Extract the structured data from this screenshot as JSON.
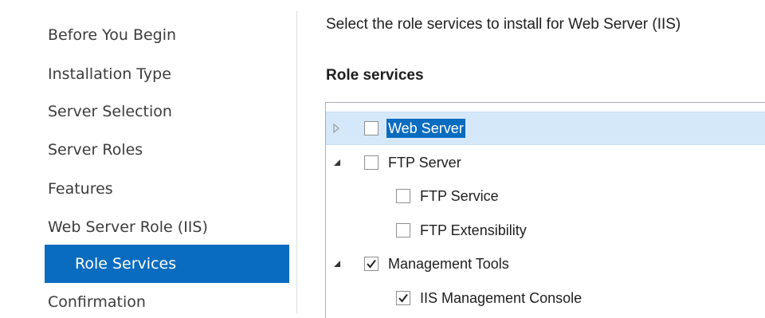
{
  "nav": {
    "items": [
      {
        "label": "Before You Begin",
        "selected": false
      },
      {
        "label": "Installation Type",
        "selected": false
      },
      {
        "label": "Server Selection",
        "selected": false
      },
      {
        "label": "Server Roles",
        "selected": false
      },
      {
        "label": "Features",
        "selected": false
      },
      {
        "label": "Web Server Role (IIS)",
        "selected": false
      },
      {
        "label": "Role Services",
        "selected": true
      },
      {
        "label": "Confirmation",
        "selected": false
      }
    ]
  },
  "main": {
    "instruction": "Select the role services to install for Web Server (IIS)",
    "section_title": "Role services",
    "tree": [
      {
        "label": "Web Server",
        "expander": "collapsed",
        "checked": false,
        "selected": true
      },
      {
        "label": "FTP Server",
        "expander": "expanded",
        "checked": false,
        "selected": false
      },
      {
        "label": "FTP Service",
        "expander": "none",
        "checked": false,
        "selected": false
      },
      {
        "label": "FTP Extensibility",
        "expander": "none",
        "checked": false,
        "selected": false
      },
      {
        "label": "Management Tools",
        "expander": "expanded",
        "checked": true,
        "selected": false
      },
      {
        "label": "IIS Management Console",
        "expander": "none",
        "checked": true,
        "selected": false
      }
    ]
  },
  "colors": {
    "selection_blue": "#0a6cbf",
    "row_highlight": "#d5e8f9"
  },
  "icons": {
    "collapsed": "triangle-right-icon",
    "expanded": "triangle-down-right-icon",
    "check": "checkmark-icon"
  }
}
